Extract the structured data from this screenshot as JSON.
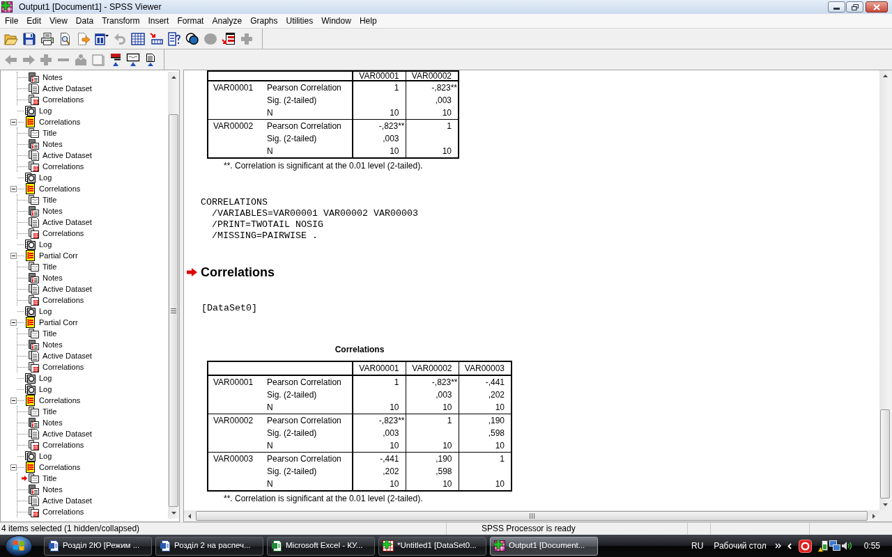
{
  "window": {
    "title": "Output1 [Document1] - SPSS Viewer"
  },
  "menu": [
    "File",
    "Edit",
    "View",
    "Data",
    "Transform",
    "Insert",
    "Format",
    "Analyze",
    "Graphs",
    "Utilities",
    "Window",
    "Help"
  ],
  "toolbars": [
    [
      {
        "kind": "open",
        "disabled": false
      },
      {
        "kind": "save",
        "disabled": false
      },
      {
        "kind": "print",
        "disabled": false
      },
      {
        "kind": "preview",
        "disabled": false
      },
      {
        "kind": "export",
        "disabled": false
      },
      {
        "kind": "recall",
        "disabled": false
      },
      {
        "kind": "undo",
        "disabled": true
      },
      {
        "kind": "data",
        "disabled": false
      },
      {
        "kind": "case",
        "disabled": false
      },
      {
        "kind": "variables",
        "disabled": false
      },
      {
        "kind": "sets",
        "disabled": false
      },
      {
        "kind": "all",
        "disabled": true
      },
      {
        "kind": "designate",
        "disabled": false
      },
      {
        "kind": "plus",
        "disabled": true
      }
    ],
    [
      {
        "kind": "back",
        "disabled": true
      },
      {
        "kind": "forward",
        "disabled": true
      },
      {
        "kind": "plus",
        "disabled": true
      },
      {
        "kind": "minus",
        "disabled": true
      },
      {
        "kind": "show",
        "disabled": true
      },
      {
        "kind": "hide",
        "disabled": true
      },
      {
        "kind": "heading",
        "disabled": false
      },
      {
        "kind": "title",
        "disabled": false
      },
      {
        "kind": "text",
        "disabled": false
      }
    ]
  ],
  "outline": [
    {
      "children": [
        {
          "label": "Notes",
          "kind": "notes",
          "current": false
        },
        {
          "label": "Active Dataset",
          "kind": "dataset",
          "current": false
        },
        {
          "label": "Correlations",
          "kind": "table",
          "current": false
        }
      ]
    },
    {
      "label": "Log",
      "kind": "log",
      "current": false
    },
    {
      "label": "Correlations",
      "kind": "folder",
      "expanded": true,
      "current": false,
      "children": [
        {
          "label": "Title",
          "kind": "title",
          "current": false
        },
        {
          "label": "Notes",
          "kind": "notes",
          "current": false
        },
        {
          "label": "Active Dataset",
          "kind": "dataset",
          "current": false
        },
        {
          "label": "Correlations",
          "kind": "table",
          "current": false
        }
      ]
    },
    {
      "label": "Log",
      "kind": "log",
      "current": false
    },
    {
      "label": "Correlations",
      "kind": "folder",
      "expanded": true,
      "current": false,
      "children": [
        {
          "label": "Title",
          "kind": "title",
          "current": false
        },
        {
          "label": "Notes",
          "kind": "notes",
          "current": false
        },
        {
          "label": "Active Dataset",
          "kind": "dataset",
          "current": false
        },
        {
          "label": "Correlations",
          "kind": "table",
          "current": false
        }
      ]
    },
    {
      "label": "Log",
      "kind": "log",
      "current": false
    },
    {
      "label": "Partial Corr",
      "kind": "folder",
      "expanded": true,
      "current": false,
      "children": [
        {
          "label": "Title",
          "kind": "title",
          "current": false
        },
        {
          "label": "Notes",
          "kind": "notes",
          "current": false
        },
        {
          "label": "Active Dataset",
          "kind": "dataset",
          "current": false
        },
        {
          "label": "Correlations",
          "kind": "table",
          "current": false
        }
      ]
    },
    {
      "label": "Log",
      "kind": "log",
      "current": false
    },
    {
      "label": "Partial Corr",
      "kind": "folder",
      "expanded": true,
      "current": false,
      "children": [
        {
          "label": "Title",
          "kind": "title",
          "current": false
        },
        {
          "label": "Notes",
          "kind": "notes",
          "current": false
        },
        {
          "label": "Active Dataset",
          "kind": "dataset",
          "current": false
        },
        {
          "label": "Correlations",
          "kind": "table",
          "current": false
        }
      ]
    },
    {
      "label": "Log",
      "kind": "log",
      "current": false
    },
    {
      "label": "Log",
      "kind": "log",
      "current": false
    },
    {
      "label": "Correlations",
      "kind": "folder",
      "expanded": true,
      "current": false,
      "children": [
        {
          "label": "Title",
          "kind": "title",
          "current": false
        },
        {
          "label": "Notes",
          "kind": "notes",
          "current": false
        },
        {
          "label": "Active Dataset",
          "kind": "dataset",
          "current": false
        },
        {
          "label": "Correlations",
          "kind": "table",
          "current": false
        }
      ]
    },
    {
      "label": "Log",
      "kind": "log",
      "current": false
    },
    {
      "label": "Correlations",
      "kind": "folder",
      "expanded": true,
      "current": false,
      "children": [
        {
          "label": "Title",
          "kind": "title",
          "current": true
        },
        {
          "label": "Notes",
          "kind": "notes",
          "current": false
        },
        {
          "label": "Active Dataset",
          "kind": "dataset",
          "current": false
        },
        {
          "label": "Correlations",
          "kind": "table",
          "current": false
        }
      ]
    }
  ],
  "output": [
    {
      "kind": "table",
      "columns": [
        "VAR00001",
        "VAR00002"
      ],
      "groups": [
        {
          "variable": "VAR00001",
          "rows": [
            {
              "statistic": "Pearson Correlation",
              "cells": [
                {
                  "value": "1"
                },
                {
                  "value": "-,823",
                  "note": "**"
                }
              ]
            },
            {
              "statistic": "Sig. (2-tailed)",
              "cells": [
                null,
                {
                  "value": ",003"
                }
              ]
            },
            {
              "statistic": "N",
              "cells": [
                {
                  "value": "10"
                },
                {
                  "value": "10"
                }
              ]
            }
          ]
        },
        {
          "variable": "VAR00002",
          "rows": [
            {
              "statistic": "Pearson Correlation",
              "cells": [
                {
                  "value": "-,823",
                  "note": "**"
                },
                {
                  "value": "1"
                }
              ]
            },
            {
              "statistic": "Sig. (2-tailed)",
              "cells": [
                {
                  "value": ",003"
                },
                null
              ]
            },
            {
              "statistic": "N",
              "cells": [
                {
                  "value": "10"
                },
                {
                  "value": "10"
                }
              ]
            }
          ]
        }
      ],
      "footnote": "**. Correlation is significant at the 0.01 level (2-tailed)."
    },
    {
      "kind": "syntax",
      "command": "CORRELATIONS",
      "subcommands": [
        "/VARIABLES=VAR00001 VAR00002 VAR00003",
        "/PRINT=TWOTAIL NOSIG",
        "/MISSING=PAIRWISE ."
      ]
    },
    {
      "kind": "heading",
      "text": "Correlations",
      "current": true
    },
    {
      "kind": "note",
      "text": "[DataSet0]"
    },
    {
      "kind": "table",
      "title": "Correlations",
      "columns": [
        "VAR00001",
        "VAR00002",
        "VAR00003"
      ],
      "groups": [
        {
          "variable": "VAR00001",
          "rows": [
            {
              "statistic": "Pearson Correlation",
              "cells": [
                {
                  "value": "1"
                },
                {
                  "value": "-,823",
                  "note": "**"
                },
                {
                  "value": "-,441"
                }
              ]
            },
            {
              "statistic": "Sig. (2-tailed)",
              "cells": [
                null,
                {
                  "value": ",003"
                },
                {
                  "value": ",202"
                }
              ]
            },
            {
              "statistic": "N",
              "cells": [
                {
                  "value": "10"
                },
                {
                  "value": "10"
                },
                {
                  "value": "10"
                }
              ]
            }
          ]
        },
        {
          "variable": "VAR00002",
          "rows": [
            {
              "statistic": "Pearson Correlation",
              "cells": [
                {
                  "value": "-,823",
                  "note": "**"
                },
                {
                  "value": "1"
                },
                {
                  "value": ",190"
                }
              ]
            },
            {
              "statistic": "Sig. (2-tailed)",
              "cells": [
                {
                  "value": ",003"
                },
                null,
                {
                  "value": ",598"
                }
              ]
            },
            {
              "statistic": "N",
              "cells": [
                {
                  "value": "10"
                },
                {
                  "value": "10"
                },
                {
                  "value": "10"
                }
              ]
            }
          ]
        },
        {
          "variable": "VAR00003",
          "rows": [
            {
              "statistic": "Pearson Correlation",
              "cells": [
                {
                  "value": "-,441"
                },
                {
                  "value": ",190"
                },
                {
                  "value": "1"
                }
              ]
            },
            {
              "statistic": "Sig. (2-tailed)",
              "cells": [
                {
                  "value": ",202"
                },
                {
                  "value": ",598"
                },
                null
              ]
            },
            {
              "statistic": "N",
              "cells": [
                {
                  "value": "10"
                },
                {
                  "value": "10"
                },
                {
                  "value": "10"
                }
              ]
            }
          ]
        }
      ],
      "footnote": "**. Correlation is significant at the 0.01 level (2-tailed)."
    }
  ],
  "status_bar": {
    "message": "4 items selected (1 hidden/collapsed)",
    "processor": "SPSS Processor is ready"
  },
  "taskbar": {
    "buttons": [
      {
        "label": "Розділ 2Ю [Режим ...",
        "kind": "document",
        "selected": false
      },
      {
        "label": "Розділ 2 на распеч...",
        "kind": "document",
        "selected": false
      },
      {
        "label": "Microsoft Excel - КУ...",
        "kind": "spreadsheet",
        "selected": false
      },
      {
        "label": "*Untitled1 [DataSet0...",
        "kind": "data",
        "selected": false
      },
      {
        "label": "Output1 [Document...",
        "kind": "output",
        "selected": true
      }
    ],
    "language": "RU",
    "desktop": "Рабочий стол",
    "clock": "0:55"
  }
}
